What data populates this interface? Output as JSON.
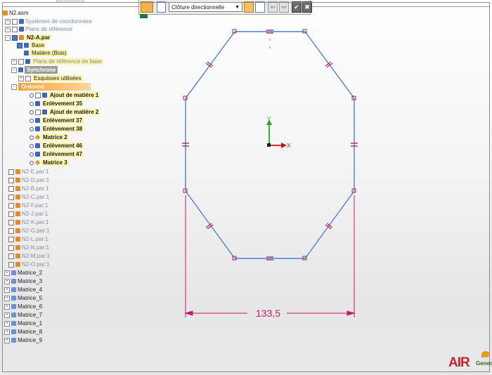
{
  "toolbar": {
    "dropdown_value": "Clôture directionnelle",
    "ok_label": "✔",
    "cancel_label": "✖",
    "prev_label": "⇦",
    "next_label": "⇨"
  },
  "tree": {
    "root": "N2.asm",
    "coord_systems": "Systèmes de coordonnées",
    "ref_planes": "Plans de référence",
    "part": "N2-A.par",
    "base": "Base",
    "material": "Matière (Bois)",
    "base_ref_planes": "Plans de référence de base",
    "synchrone": "Synchrone",
    "sketches_used": "Esquisses utilisées",
    "ordonne": "Ordonné",
    "features": [
      {
        "label": "Ajout de matière 1",
        "icon": "add-material-icon"
      },
      {
        "label": "Enlèvement 35",
        "icon": "cut-icon"
      },
      {
        "label": "Ajout de matière 2",
        "icon": "add-material-icon"
      },
      {
        "label": "Enlèvement 37",
        "icon": "cut-icon"
      },
      {
        "label": "Enlèvement 38",
        "icon": "cut-icon"
      },
      {
        "label": "Matrice 2",
        "icon": "pattern-icon"
      },
      {
        "label": "Enlèvement 46",
        "icon": "cut-icon"
      },
      {
        "label": "Enlèvement 47",
        "icon": "cut-icon"
      },
      {
        "label": "Matrice 3",
        "icon": "pattern-icon"
      }
    ],
    "parts": [
      "N2-E.par:1",
      "N2-D.par:1",
      "N2-B.par:1",
      "N2-C.par:1",
      "N2-F.par:1",
      "N2-J.par:1",
      "N2-K.par:1",
      "N2-G.par:1",
      "N2-L.par:1",
      "N2-N.par:1",
      "N2-M.par:1",
      "N2-O.par:1"
    ],
    "patterns": [
      "Matrice_2",
      "Matrice_3",
      "Matrice_4",
      "Matrice_5",
      "Matrice_6",
      "Matrice_7",
      "Matrice_1",
      "Matrice_8",
      "Matrice_9"
    ]
  },
  "sketch": {
    "dimension_value": "133,5",
    "axis_x": "X",
    "axis_y": "Y"
  },
  "colors": {
    "sketch_line": "#4a7fd6",
    "constraint": "#b0205e",
    "dimension": "#c21a6a",
    "axis_x": "#cc1111",
    "axis_y": "#22aa22",
    "highlight": "#fff6a8",
    "accent_orange": "#f6a23a"
  },
  "logos": {
    "air": "AIR",
    "geneo": "Geneo"
  }
}
